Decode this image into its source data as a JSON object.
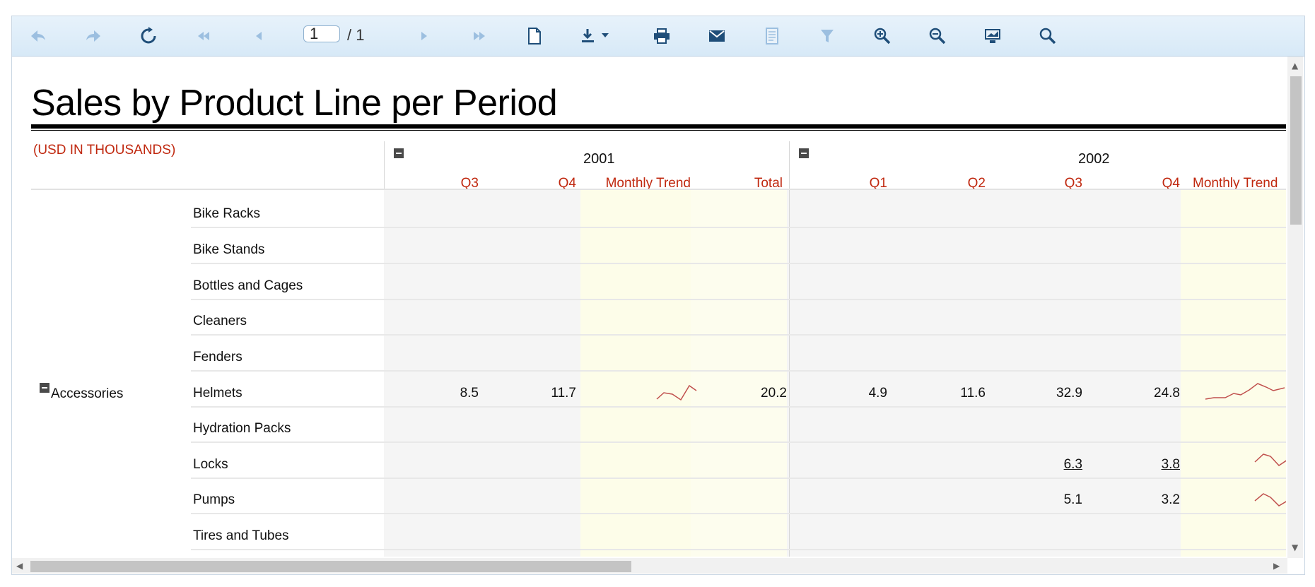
{
  "toolbar": {
    "page_current": "1",
    "page_total": "/ 1",
    "icons": [
      "back-icon",
      "forward-icon",
      "refresh-icon",
      "first-page-icon",
      "prev-page-icon",
      "next-page-icon",
      "last-page-icon",
      "page-setup-icon",
      "export-icon",
      "print-icon",
      "email-icon",
      "document-map-icon",
      "filter-icon",
      "zoom-in-icon",
      "zoom-out-icon",
      "fullscreen-icon",
      "search-icon"
    ]
  },
  "report": {
    "title": "Sales by Product Line per Period",
    "units_label": "(USD IN THOUSANDS)",
    "years": [
      "2001",
      "2002"
    ],
    "columns_2001": [
      "Q3",
      "Q4",
      "Monthly Trend",
      "Total"
    ],
    "columns_2002": [
      "Q1",
      "Q2",
      "Q3",
      "Q4",
      "Monthly Trend"
    ],
    "category": "Accessories",
    "products": [
      "Bike Racks",
      "Bike Stands",
      "Bottles and Cages",
      "Cleaners",
      "Fenders",
      "Helmets",
      "Hydration Packs",
      "Locks",
      "Pumps",
      "Tires and Tubes"
    ],
    "helmets": {
      "q3_2001": "8.5",
      "q4_2001": "11.7",
      "total_2001": "20.2",
      "q1_2002": "4.9",
      "q2_2002": "11.6",
      "q3_2002": "32.9",
      "q4_2002": "24.8"
    },
    "locks": {
      "q3_2002": "6.3",
      "q4_2002": "3.8"
    },
    "pumps": {
      "q3_2002": "5.1",
      "q4_2002": "3.2"
    }
  },
  "colors": {
    "accent_red": "#c0280f",
    "toolbar_bg": "#dcecf8",
    "trend_bg": "#fdfde9"
  }
}
